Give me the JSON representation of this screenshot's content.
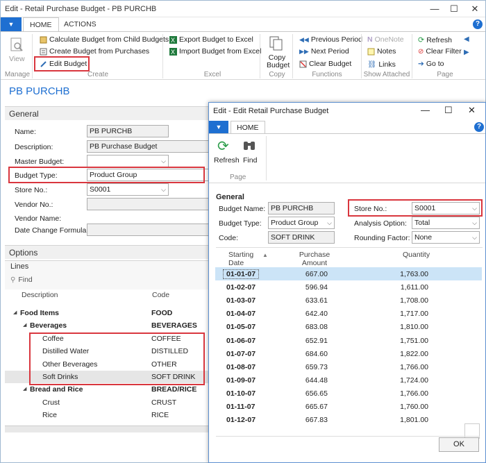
{
  "main_window": {
    "title": "Edit - Retail Purchase Budget - PB PURCHB",
    "tabs": [
      "HOME",
      "ACTIONS"
    ],
    "ribbon": {
      "view_label": "View",
      "manage_label": "Manage",
      "calc_budget": "Calculate Budget from Child Budgets",
      "create_budget": "Create Budget from Purchases",
      "edit_budget": "Edit Budget",
      "create_label": "Create",
      "export_excel": "Export Budget to Excel",
      "import_excel": "Import Budget from Excel",
      "excel_label": "Excel",
      "copy_budget_1": "Copy",
      "copy_budget_2": "Budget",
      "copy_label": "Copy",
      "prev_period": "Previous Period",
      "next_period": "Next Period",
      "clear_budget": "Clear Budget",
      "functions_label": "Functions",
      "onenote": "OneNote",
      "notes": "Notes",
      "links": "Links",
      "show_attached_label": "Show Attached",
      "refresh": "Refresh",
      "clear_filter": "Clear Filter",
      "go_to": "Go to",
      "page_label": "Page"
    },
    "page_title": "PB PURCHB",
    "general": {
      "section": "General",
      "name_label": "Name:",
      "name_value": "PB PURCHB",
      "description_label": "Description:",
      "description_value": "PB Purchase Budget",
      "master_budget_label": "Master Budget:",
      "master_budget_value": "",
      "budget_type_label": "Budget Type:",
      "budget_type_value": "Product Group",
      "store_no_label": "Store No.:",
      "store_no_value": "S0001",
      "vendor_no_label": "Vendor No.:",
      "vendor_name_label": "Vendor Name:",
      "date_change_label": "Date Change Formula:"
    },
    "options_section": "Options",
    "lines": {
      "section": "Lines",
      "find": "Find",
      "col_description": "Description",
      "col_code": "Code",
      "rows": [
        {
          "desc": "Food Items",
          "code": "FOOD",
          "level": 0,
          "bold": true,
          "toggle": "◢"
        },
        {
          "desc": "Beverages",
          "code": "BEVERAGES",
          "level": 1,
          "bold": true,
          "toggle": "◢"
        },
        {
          "desc": "Coffee",
          "code": "COFFEE",
          "level": 2,
          "bold": false,
          "toggle": ""
        },
        {
          "desc": "Distilled Water",
          "code": "DISTILLED",
          "level": 2,
          "bold": false,
          "toggle": ""
        },
        {
          "desc": "Other Beverages",
          "code": "OTHER",
          "level": 2,
          "bold": false,
          "toggle": ""
        },
        {
          "desc": "Soft Drinks",
          "code": "SOFT DRINK",
          "level": 2,
          "bold": false,
          "toggle": ""
        },
        {
          "desc": "Bread and Rice",
          "code": "BREAD/RICE",
          "level": 1,
          "bold": true,
          "toggle": "◢"
        },
        {
          "desc": "Crust",
          "code": "CRUST",
          "level": 2,
          "bold": false,
          "toggle": ""
        },
        {
          "desc": "Rice",
          "code": "RICE",
          "level": 2,
          "bold": false,
          "toggle": ""
        }
      ]
    }
  },
  "dialog": {
    "title": "Edit - Edit Retail Purchase Budget",
    "tab": "HOME",
    "refresh": "Refresh",
    "find": "Find",
    "page_label": "Page",
    "general": "General",
    "budget_name_label": "Budget Name:",
    "budget_name_value": "PB PURCHB",
    "budget_type_label": "Budget Type:",
    "budget_type_value": "Product Group",
    "code_label": "Code:",
    "code_value": "SOFT DRINK",
    "store_no_label": "Store No.:",
    "store_no_value": "S0001",
    "analysis_label": "Analysis Option:",
    "analysis_value": "Total",
    "rounding_label": "Rounding Factor:",
    "rounding_value": "None",
    "col_date_1": "Starting",
    "col_date_2": "Date",
    "col_amount_1": "Purchase",
    "col_amount_2": "Amount",
    "col_qty": "Quantity",
    "rows": [
      {
        "date": "01-01-07",
        "amount": "667.00",
        "qty": "1,763.00"
      },
      {
        "date": "01-02-07",
        "amount": "596.94",
        "qty": "1,611.00"
      },
      {
        "date": "01-03-07",
        "amount": "633.61",
        "qty": "1,708.00"
      },
      {
        "date": "01-04-07",
        "amount": "642.40",
        "qty": "1,717.00"
      },
      {
        "date": "01-05-07",
        "amount": "683.08",
        "qty": "1,810.00"
      },
      {
        "date": "01-06-07",
        "amount": "652.91",
        "qty": "1,751.00"
      },
      {
        "date": "01-07-07",
        "amount": "684.60",
        "qty": "1,822.00"
      },
      {
        "date": "01-08-07",
        "amount": "659.73",
        "qty": "1,766.00"
      },
      {
        "date": "01-09-07",
        "amount": "644.48",
        "qty": "1,724.00"
      },
      {
        "date": "01-10-07",
        "amount": "656.65",
        "qty": "1,766.00"
      },
      {
        "date": "01-11-07",
        "amount": "665.67",
        "qty": "1,760.00"
      },
      {
        "date": "01-12-07",
        "amount": "667.83",
        "qty": "1,801.00"
      }
    ],
    "ok": "OK"
  }
}
